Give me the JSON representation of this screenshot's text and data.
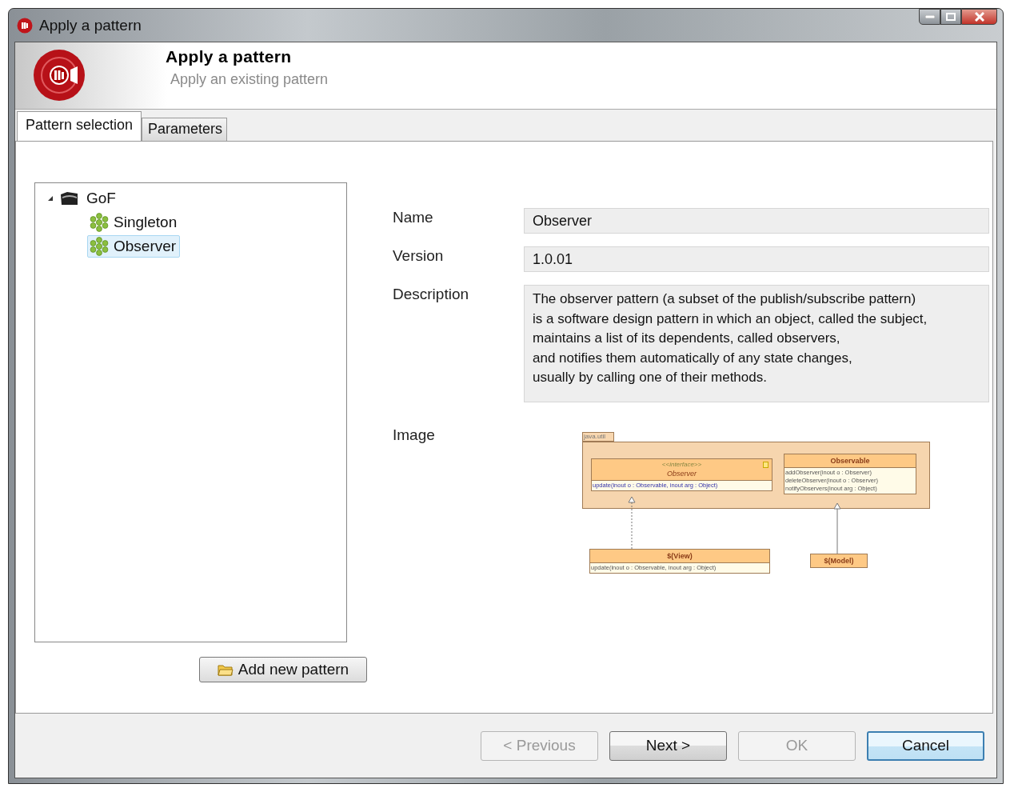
{
  "window": {
    "title": "Apply a pattern"
  },
  "header": {
    "title": "Apply a pattern",
    "subtitle": "Apply an existing pattern"
  },
  "tabs": [
    {
      "label": "Pattern selection",
      "selected": true
    },
    {
      "label": "Parameters",
      "selected": false
    }
  ],
  "tree": [
    {
      "label": "GoF",
      "kind": "folder",
      "expanded": true,
      "selected": false,
      "children": [
        {
          "label": "Singleton",
          "kind": "pattern",
          "selected": false
        },
        {
          "label": "Observer",
          "kind": "pattern",
          "selected": true
        }
      ]
    }
  ],
  "add_button": "Add new pattern",
  "details": {
    "name_label": "Name",
    "name": "Observer",
    "version_label": "Version",
    "version": "1.0.01",
    "description_label": "Description",
    "description": [
      "The observer pattern (a subset of the publish/subscribe pattern)",
      "is a software design pattern in which an object, called the subject,",
      "maintains a list of its dependents, called observers,",
      "and notifies them automatically of any state changes,",
      "usually by calling one of their methods."
    ],
    "image_label": "Image"
  },
  "diagram": {
    "package": "java.util",
    "classes": [
      {
        "stereotype": "<<interface>>",
        "name": "Observer",
        "interface": true,
        "members": [
          "update(inout o : Observable, inout arg : Object)"
        ]
      },
      {
        "name": "Observable",
        "interface": false,
        "members": [
          "addObserver(inout o : Observer)",
          "deleteObserver(inout o : Observer)",
          "notifyObservers(inout arg : Object)"
        ]
      },
      {
        "name": "$(View)",
        "interface": false,
        "members": [
          "update(inout o : Observable, inout arg : Object)"
        ]
      },
      {
        "name": "$(Model)",
        "interface": false
      }
    ],
    "relations": [
      {
        "kind": "realization"
      },
      {
        "kind": "generalization"
      }
    ]
  },
  "buttons": [
    {
      "label": "< Previous",
      "disabled": true,
      "default": false
    },
    {
      "label": "Next >",
      "disabled": false,
      "default": false
    },
    {
      "label": "OK",
      "disabled": true,
      "default": false
    },
    {
      "label": "Cancel",
      "disabled": false,
      "default": true
    }
  ]
}
